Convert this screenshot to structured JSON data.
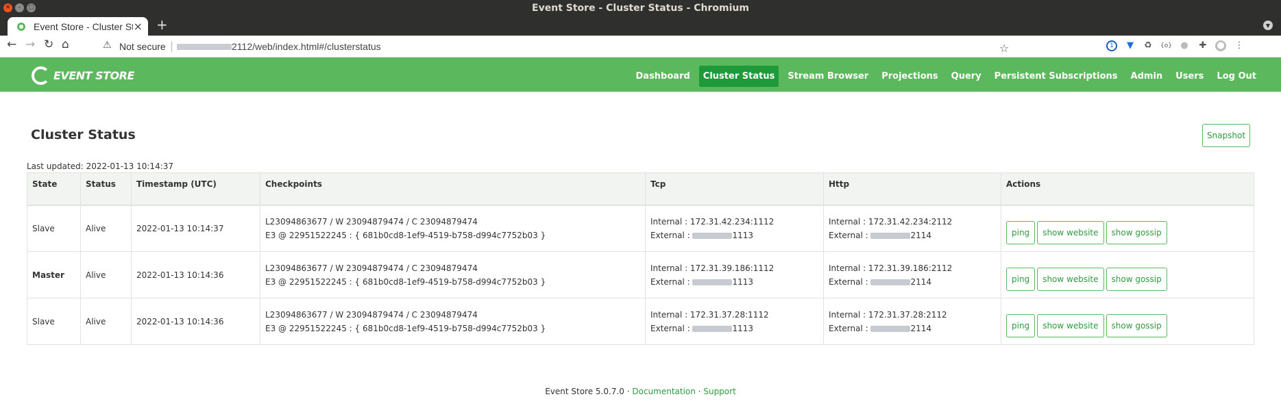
{
  "window": {
    "title": "Event Store - Cluster Status - Chromium"
  },
  "browser": {
    "tab_title": "Event Store - Cluster Status",
    "new_tab_icon": "plus-icon",
    "security_label": "Not secure",
    "url_visible": "2112/web/index.html#/clusterstatus"
  },
  "app": {
    "logo_text": "EVENT STORE",
    "nav": [
      {
        "label": "Dashboard",
        "active": false
      },
      {
        "label": "Cluster Status",
        "active": true
      },
      {
        "label": "Stream Browser",
        "active": false
      },
      {
        "label": "Projections",
        "active": false
      },
      {
        "label": "Query",
        "active": false
      },
      {
        "label": "Persistent Subscriptions",
        "active": false
      },
      {
        "label": "Admin",
        "active": false
      },
      {
        "label": "Users",
        "active": false
      },
      {
        "label": "Log Out",
        "active": false
      }
    ],
    "colors": {
      "brand": "#5cb85c",
      "active_nav": "#1f9a3b",
      "link": "#2e9a3f"
    }
  },
  "page": {
    "title": "Cluster Status",
    "snapshot_label": "Snapshot",
    "last_updated": "Last updated: 2022-01-13 10:14:37"
  },
  "table": {
    "headers": [
      "State",
      "Status",
      "Timestamp (UTC)",
      "Checkpoints",
      "Tcp",
      "Http",
      "Actions"
    ],
    "rows": [
      {
        "state": "Slave",
        "status": "Alive",
        "timestamp": "2022-01-13 10:14:37",
        "checkpoint_line1": "L23094863677 / W 23094879474 / C 23094879474",
        "checkpoint_line2": "E3 @ 22951522245 : { 681b0cd8-1ef9-4519-b758-d994c7752b03 }",
        "tcp_internal": "Internal : 172.31.42.234:1112",
        "tcp_external_prefix": "External : ",
        "tcp_external_suffix": "1113",
        "http_internal": "Internal : 172.31.42.234:2112",
        "http_external_prefix": "External : ",
        "http_external_suffix": "2114"
      },
      {
        "state": "Master",
        "status": "Alive",
        "timestamp": "2022-01-13 10:14:36",
        "checkpoint_line1": "L23094863677 / W 23094879474 / C 23094879474",
        "checkpoint_line2": "E3 @ 22951522245 : { 681b0cd8-1ef9-4519-b758-d994c7752b03 }",
        "tcp_internal": "Internal : 172.31.39.186:1112",
        "tcp_external_prefix": "External : ",
        "tcp_external_suffix": "1113",
        "http_internal": "Internal : 172.31.39.186:2112",
        "http_external_prefix": "External : ",
        "http_external_suffix": "2114"
      },
      {
        "state": "Slave",
        "status": "Alive",
        "timestamp": "2022-01-13 10:14:36",
        "checkpoint_line1": "L23094863677 / W 23094879474 / C 23094879474",
        "checkpoint_line2": "E3 @ 22951522245 : { 681b0cd8-1ef9-4519-b758-d994c7752b03 }",
        "tcp_internal": "Internal : 172.31.37.28:1112",
        "tcp_external_prefix": "External : ",
        "tcp_external_suffix": "1113",
        "http_internal": "Internal : 172.31.37.28:2112",
        "http_external_prefix": "External : ",
        "http_external_suffix": "2114"
      }
    ],
    "actions": {
      "ping": "ping",
      "show_website": "show website",
      "show_gossip": "show gossip"
    }
  },
  "footer": {
    "version": "Event Store 5.0.7.0",
    "separator": " · ",
    "documentation": "Documentation",
    "support": "Support"
  }
}
